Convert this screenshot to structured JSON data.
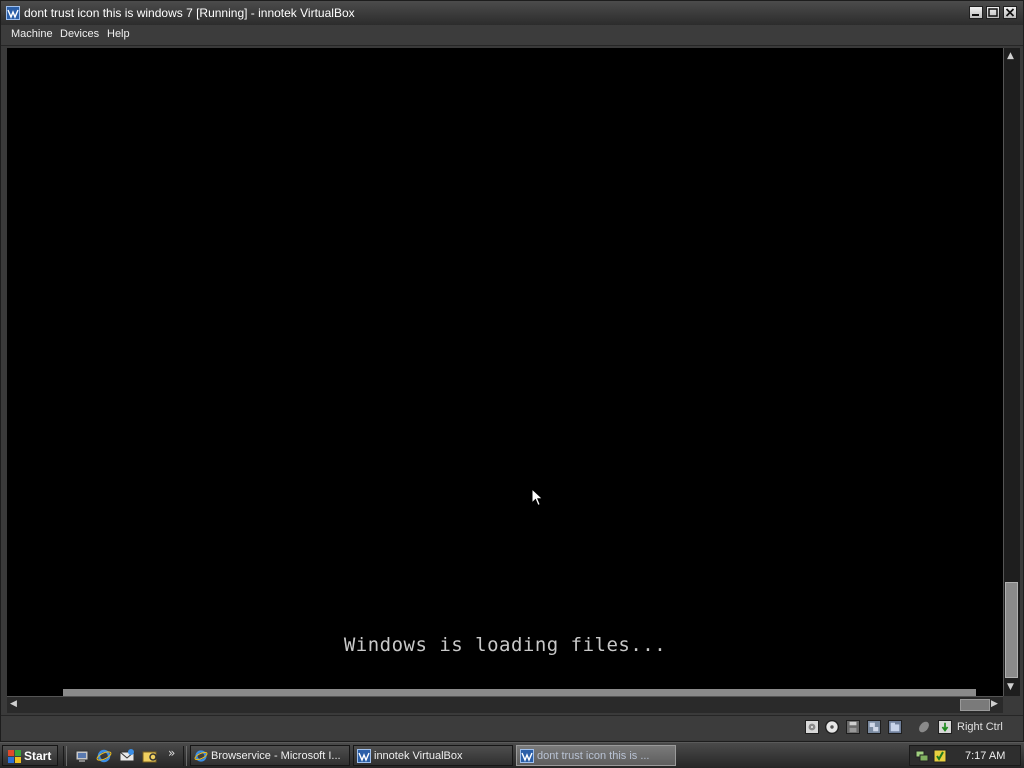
{
  "window": {
    "title": "dont trust icon this is windows 7 [Running] - innotek VirtualBox",
    "menu": [
      "Machine",
      "Devices",
      "Help"
    ]
  },
  "vm": {
    "screen_text": "Windows is loading files..."
  },
  "statusbar": {
    "host_key": "Right Ctrl",
    "icons": [
      "hard-disk-icon",
      "cd-icon",
      "floppy-icon",
      "network-icon",
      "shared-folders-icon",
      "mouse-integration-icon",
      "host-key-icon"
    ]
  },
  "taskbar": {
    "start_label": "Start",
    "more_label": "»",
    "tasks": [
      {
        "label": "Browservice - Microsoft I...",
        "icon": "ie-icon"
      },
      {
        "label": "innotek VirtualBox",
        "icon": "virtualbox-icon"
      },
      {
        "label": "dont trust icon this is ...",
        "icon": "virtualbox-icon"
      }
    ],
    "clock": "7:17 AM"
  },
  "colors": {
    "vm_background": "#000000",
    "window_chrome": "#3a3a3a",
    "vm_text": "#c8c8c8"
  }
}
